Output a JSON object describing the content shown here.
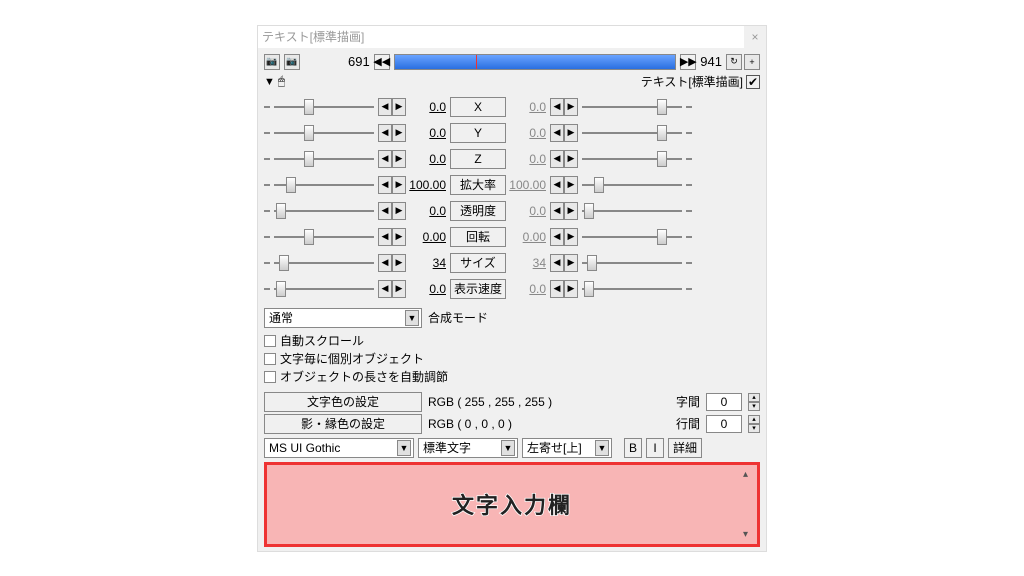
{
  "title": "テキスト[標準描画]",
  "time": {
    "start": "691",
    "end": "941"
  },
  "header": {
    "label": "テキスト[標準描画]"
  },
  "params": [
    {
      "left": "0.0",
      "label": "X",
      "right": "0.0",
      "lth": 30,
      "rth": 75
    },
    {
      "left": "0.0",
      "label": "Y",
      "right": "0.0",
      "lth": 30,
      "rth": 75
    },
    {
      "left": "0.0",
      "label": "Z",
      "right": "0.0",
      "lth": 30,
      "rth": 75
    },
    {
      "left": "100.00",
      "label": "拡大率",
      "right": "100.00",
      "lth": 12,
      "rth": 12
    },
    {
      "left": "0.0",
      "label": "透明度",
      "right": "0.0",
      "lth": 2,
      "rth": 2
    },
    {
      "left": "0.00",
      "label": "回転",
      "right": "0.00",
      "lth": 30,
      "rth": 75
    },
    {
      "left": "34",
      "label": "サイズ",
      "right": "34",
      "lth": 5,
      "rth": 5
    },
    {
      "left": "0.0",
      "label": "表示速度",
      "right": "0.0",
      "lth": 2,
      "rth": 2
    }
  ],
  "blend": {
    "value": "通常",
    "label": "合成モード"
  },
  "checks": [
    "自動スクロール",
    "文字毎に個別オブジェクト",
    "オブジェクトの長さを自動調節"
  ],
  "colors": {
    "text_btn": "文字色の設定",
    "text_val": "RGB ( 255 , 255 , 255 )",
    "shadow_btn": "影・縁色の設定",
    "shadow_val": "RGB ( 0 , 0 , 0 )",
    "spacing_lab": "字間",
    "spacing_val": "0",
    "line_lab": "行間",
    "line_val": "0"
  },
  "font": {
    "name": "MS UI Gothic",
    "style": "標準文字",
    "align": "左寄せ[上]",
    "bold": "B",
    "italic": "I",
    "detail": "詳細"
  },
  "textarea_label": "文字入力欄"
}
